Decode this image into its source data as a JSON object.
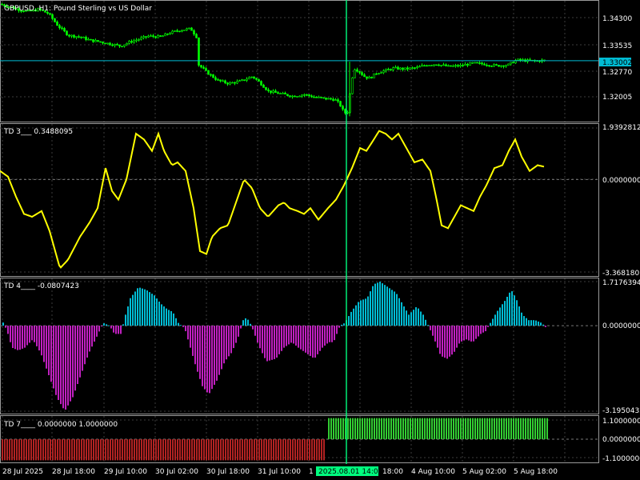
{
  "chart_data": [
    {
      "type": "candlestick",
      "title": "GBPUSD, H1: Pound Sterling vs US Dollar",
      "y_ticks": [
        "1.34300",
        "1.33535",
        "1.32770",
        "1.32005"
      ],
      "current_price_label": "1.33002",
      "current_price": 1.33002,
      "ylim": [
        1.3152,
        1.3446
      ],
      "close_path": [
        [
          0,
          1.3438
        ],
        [
          10,
          1.3432
        ],
        [
          22,
          1.3425
        ],
        [
          35,
          1.342
        ],
        [
          48,
          1.3425
        ],
        [
          60,
          1.3415
        ],
        [
          72,
          1.3385
        ],
        [
          85,
          1.3362
        ],
        [
          100,
          1.3358
        ],
        [
          112,
          1.335
        ],
        [
          122,
          1.3347
        ],
        [
          135,
          1.3342
        ],
        [
          150,
          1.3336
        ],
        [
          162,
          1.3346
        ],
        [
          172,
          1.3352
        ],
        [
          185,
          1.336
        ],
        [
          200,
          1.3358
        ],
        [
          212,
          1.3368
        ],
        [
          225,
          1.3375
        ],
        [
          238,
          1.3378
        ],
        [
          246,
          1.3356
        ],
        [
          248,
          1.329
        ],
        [
          258,
          1.3272
        ],
        [
          272,
          1.3252
        ],
        [
          285,
          1.3245
        ],
        [
          300,
          1.325
        ],
        [
          315,
          1.3262
        ],
        [
          325,
          1.3246
        ],
        [
          335,
          1.3226
        ],
        [
          350,
          1.322
        ],
        [
          365,
          1.3214
        ],
        [
          380,
          1.3218
        ],
        [
          392,
          1.3212
        ],
        [
          405,
          1.3208
        ],
        [
          418,
          1.3206
        ],
        [
          424,
          1.3195
        ],
        [
          430,
          1.3172
        ],
        [
          435,
          1.3178
        ],
        [
          438,
          1.324
        ],
        [
          442,
          1.3282
        ],
        [
          448,
          1.3275
        ],
        [
          456,
          1.326
        ],
        [
          462,
          1.3258
        ],
        [
          470,
          1.327
        ],
        [
          480,
          1.3276
        ],
        [
          492,
          1.3282
        ],
        [
          505,
          1.328
        ],
        [
          520,
          1.3283
        ],
        [
          532,
          1.329
        ],
        [
          545,
          1.3292
        ],
        [
          560,
          1.3286
        ],
        [
          575,
          1.3288
        ],
        [
          590,
          1.3294
        ],
        [
          605,
          1.3292
        ],
        [
          620,
          1.3288
        ],
        [
          635,
          1.329
        ],
        [
          645,
          1.3302
        ],
        [
          660,
          1.33
        ],
        [
          672,
          1.33
        ],
        [
          680,
          1.3301
        ]
      ]
    },
    {
      "type": "line",
      "title": "TD 3___ 0.3488095",
      "y_ticks": [
        "1.9392812",
        "0.0000000",
        "-3.3681801"
      ],
      "ylim": [
        -3.3681801,
        1.9392812
      ],
      "color": "#ffff00",
      "series": [
        [
          0,
          0.3
        ],
        [
          10,
          0.1
        ],
        [
          20,
          -0.6
        ],
        [
          30,
          -1.2
        ],
        [
          40,
          -1.3
        ],
        [
          52,
          -1.1
        ],
        [
          62,
          -1.8
        ],
        [
          75,
          -3.1
        ],
        [
          85,
          -2.8
        ],
        [
          100,
          -2.0
        ],
        [
          112,
          -1.5
        ],
        [
          122,
          -1.0
        ],
        [
          132,
          0.4
        ],
        [
          140,
          -0.4
        ],
        [
          148,
          -0.7
        ],
        [
          158,
          0.0
        ],
        [
          170,
          1.6
        ],
        [
          180,
          1.4
        ],
        [
          190,
          1.0
        ],
        [
          198,
          1.6
        ],
        [
          205,
          1.0
        ],
        [
          215,
          0.5
        ],
        [
          222,
          0.6
        ],
        [
          232,
          0.3
        ],
        [
          242,
          -1.0
        ],
        [
          250,
          -2.5
        ],
        [
          258,
          -2.6
        ],
        [
          265,
          -2.0
        ],
        [
          275,
          -1.7
        ],
        [
          285,
          -1.6
        ],
        [
          295,
          -0.8
        ],
        [
          305,
          0.0
        ],
        [
          315,
          -0.3
        ],
        [
          325,
          -1.0
        ],
        [
          335,
          -1.3
        ],
        [
          348,
          -0.9
        ],
        [
          355,
          -0.8
        ],
        [
          362,
          -1.0
        ],
        [
          372,
          -1.1
        ],
        [
          380,
          -1.2
        ],
        [
          388,
          -1.0
        ],
        [
          398,
          -1.4
        ],
        [
          410,
          -1.0
        ],
        [
          420,
          -0.7
        ],
        [
          430,
          -0.2
        ],
        [
          440,
          0.4
        ],
        [
          450,
          1.1
        ],
        [
          458,
          1.0
        ],
        [
          465,
          1.3
        ],
        [
          474,
          1.7
        ],
        [
          482,
          1.6
        ],
        [
          490,
          1.4
        ],
        [
          498,
          1.6
        ],
        [
          508,
          1.1
        ],
        [
          518,
          0.6
        ],
        [
          528,
          0.7
        ],
        [
          538,
          0.3
        ],
        [
          545,
          -0.6
        ],
        [
          552,
          -1.6
        ],
        [
          560,
          -1.7
        ],
        [
          568,
          -1.3
        ],
        [
          576,
          -0.9
        ],
        [
          584,
          -1.0
        ],
        [
          592,
          -1.1
        ],
        [
          600,
          -0.6
        ],
        [
          608,
          -0.2
        ],
        [
          618,
          0.4
        ],
        [
          628,
          0.5
        ],
        [
          636,
          1.0
        ],
        [
          644,
          1.4
        ],
        [
          652,
          0.8
        ],
        [
          662,
          0.3
        ],
        [
          672,
          0.5
        ],
        [
          680,
          0.45
        ]
      ]
    },
    {
      "type": "bar",
      "title": "TD 4____ -0.0807423",
      "y_ticks": [
        "1.7176394",
        "0.0000000",
        "-3.1950432"
      ],
      "ylim": [
        -3.1950432,
        1.7176394
      ],
      "positive_color": "#00bcd4",
      "negative_color": "#c020c0",
      "series": [
        [
          0,
          0.3
        ],
        [
          8,
          -0.2
        ],
        [
          14,
          -0.8
        ],
        [
          22,
          -0.9
        ],
        [
          30,
          -0.8
        ],
        [
          40,
          -0.5
        ],
        [
          50,
          -1.0
        ],
        [
          60,
          -1.8
        ],
        [
          70,
          -2.6
        ],
        [
          80,
          -3.1
        ],
        [
          90,
          -2.6
        ],
        [
          100,
          -1.8
        ],
        [
          110,
          -1.0
        ],
        [
          120,
          -0.4
        ],
        [
          128,
          0.1
        ],
        [
          136,
          0.0
        ],
        [
          142,
          -0.3
        ],
        [
          150,
          -0.3
        ],
        [
          156,
          0.4
        ],
        [
          162,
          1.0
        ],
        [
          172,
          1.4
        ],
        [
          182,
          1.3
        ],
        [
          192,
          1.1
        ],
        [
          200,
          0.8
        ],
        [
          208,
          0.6
        ],
        [
          215,
          0.5
        ],
        [
          222,
          0.1
        ],
        [
          230,
          -0.1
        ],
        [
          236,
          -0.7
        ],
        [
          244,
          -1.5
        ],
        [
          252,
          -2.2
        ],
        [
          260,
          -2.5
        ],
        [
          270,
          -2.0
        ],
        [
          280,
          -1.3
        ],
        [
          288,
          -1.0
        ],
        [
          296,
          -0.5
        ],
        [
          304,
          0.3
        ],
        [
          310,
          0.2
        ],
        [
          316,
          -0.2
        ],
        [
          322,
          -0.7
        ],
        [
          332,
          -1.3
        ],
        [
          344,
          -1.2
        ],
        [
          354,
          -0.8
        ],
        [
          364,
          -0.6
        ],
        [
          372,
          -0.8
        ],
        [
          382,
          -1.0
        ],
        [
          392,
          -1.2
        ],
        [
          402,
          -0.8
        ],
        [
          410,
          -0.6
        ],
        [
          416,
          -0.6
        ],
        [
          424,
          0.0
        ],
        [
          430,
          0.1
        ],
        [
          438,
          0.5
        ],
        [
          448,
          0.9
        ],
        [
          458,
          1.0
        ],
        [
          466,
          1.5
        ],
        [
          474,
          1.6
        ],
        [
          484,
          1.4
        ],
        [
          494,
          1.2
        ],
        [
          502,
          0.8
        ],
        [
          510,
          0.4
        ],
        [
          520,
          0.7
        ],
        [
          528,
          0.4
        ],
        [
          536,
          -0.1
        ],
        [
          542,
          -0.5
        ],
        [
          550,
          -1.1
        ],
        [
          558,
          -1.2
        ],
        [
          566,
          -1.0
        ],
        [
          574,
          -0.6
        ],
        [
          582,
          -0.5
        ],
        [
          590,
          -0.6
        ],
        [
          600,
          -0.3
        ],
        [
          606,
          -0.2
        ],
        [
          612,
          0.1
        ],
        [
          620,
          0.5
        ],
        [
          630,
          0.9
        ],
        [
          638,
          1.3
        ],
        [
          644,
          1.0
        ],
        [
          652,
          0.4
        ],
        [
          660,
          0.2
        ],
        [
          668,
          0.2
        ],
        [
          676,
          0.1
        ],
        [
          682,
          -0.08
        ]
      ]
    },
    {
      "type": "bar",
      "title": "TD 7____ 0.0000000 1.0000000",
      "y_ticks": [
        "1.1000000",
        "0.0000000",
        "-1.1000000"
      ],
      "ylim": [
        -1.1,
        1.1
      ],
      "positive_color": "#32cd32",
      "negative_color": "#b22222",
      "segments": [
        {
          "from": 0,
          "to": 406,
          "value": -1.0
        },
        {
          "from": 408,
          "to": 684,
          "value": 1.0
        }
      ]
    }
  ],
  "x_ticks": [
    "28 Jul 2025",
    "28 Jul 18:00",
    "29 Jul 10:00",
    "30 Jul 02:00",
    "30 Jul 18:00",
    "31 Jul 10:00",
    "1",
    "18:00",
    "4 Aug 10:00",
    "5 Aug 02:00",
    "5 Aug 18:00"
  ],
  "cursor_time_label": "2025.08.01 14:00",
  "colors": {
    "background": "#000000",
    "grid": "#3c3c3c",
    "candle": "#00ff00",
    "cursor": "#00ff7f",
    "price_line": "#00bcd4"
  }
}
